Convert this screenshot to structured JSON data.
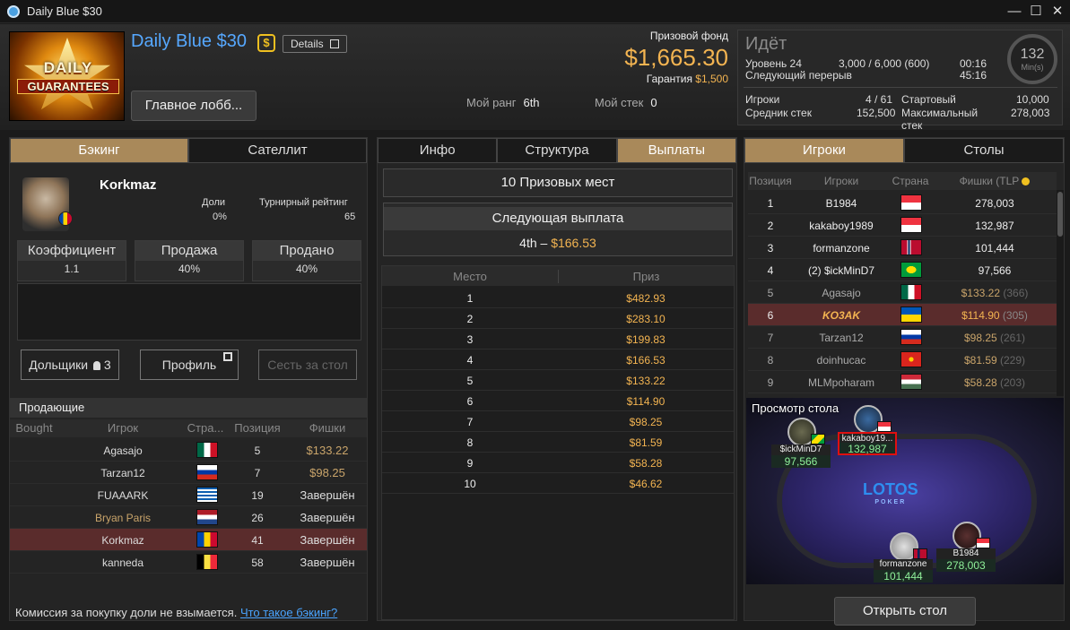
{
  "window": {
    "title": "Daily Blue $30"
  },
  "header": {
    "logo_line1": "DAILY",
    "logo_line2": "GUARANTEES",
    "tournament_name": "Daily Blue $30",
    "currency_badge": "$",
    "details_label": "Details",
    "lobby_button": "Главное лобб...",
    "prize_pool_label": "Призовой фонд",
    "prize_pool_amount": "$1,665.30",
    "guarantee_label": "Гарантия",
    "guarantee_amount": "$1,500",
    "my_rank_label": "Мой ранг",
    "my_rank_value": "6th",
    "my_stack_label": "Мой стек",
    "my_stack_value": "0"
  },
  "status": {
    "state": "Идёт",
    "level_label": "Уровень 24",
    "blinds": "3,000 / 6,000 (600)",
    "level_time": "00:16",
    "next_break_label": "Следующий перерыв",
    "break_time": "45:16",
    "clock_value": "132",
    "clock_unit": "Min(s)",
    "players_label": "Игроки",
    "players_value": "4 / 61",
    "starting_label": "Стартовый",
    "starting_value": "10,000",
    "avg_stack_label": "Средник стек",
    "avg_stack_value": "152,500",
    "max_label": "Максимальный стек",
    "max_value": "278,003"
  },
  "left": {
    "tabs": [
      "Бэкинг",
      "Сателлит"
    ],
    "player_name": "Korkmaz",
    "shares_label": "Доли",
    "shares_value": "0%",
    "rating_label": "Турнирный рейтинг",
    "rating_value": "65",
    "coef_label": "Коэффициент",
    "coef_value": "1.1",
    "sale_label": "Продажа",
    "sale_value": "40%",
    "sold_label": "Продано",
    "sold_value": "40%",
    "backers_button": "Дольщики",
    "backers_count": "3",
    "profile_button": "Профиль",
    "sit_button": "Сесть за стол",
    "sellers_title": "Продающие",
    "sellers_columns": [
      "Bought",
      "Игрок",
      "Стра...",
      "Позиция",
      "Фишки"
    ],
    "sellers": [
      {
        "name": "Agasajo",
        "flag": "mexico",
        "pos": "5",
        "chips": "$133.22"
      },
      {
        "name": "Tarzan12",
        "flag": "russia",
        "pos": "7",
        "chips": "$98.25"
      },
      {
        "name": "FUAAARK",
        "flag": "greece",
        "pos": "19",
        "chips": "Завершён"
      },
      {
        "name": "Bryan Paris",
        "flag": "netherlands",
        "pos": "26",
        "chips": "Завершён"
      },
      {
        "name": "Korkmaz",
        "flag": "moldova",
        "pos": "41",
        "chips": "Завершён"
      },
      {
        "name": "kanneda",
        "flag": "belgium",
        "pos": "58",
        "chips": "Завершён"
      }
    ],
    "commission_text": "Комиссия за покупку доли не взымается.",
    "commission_link": "Что такое бэкинг?"
  },
  "middle": {
    "tabs": [
      "Инфо",
      "Структура",
      "Выплаты"
    ],
    "prize_places": "10 Призовых мест",
    "next_payout_label": "Следующая выплата",
    "next_payout_place": "4th –",
    "next_payout_amount": "$166.53",
    "columns": [
      "Место",
      "Приз"
    ],
    "payouts": [
      {
        "place": "1",
        "amount": "$482.93"
      },
      {
        "place": "2",
        "amount": "$283.10"
      },
      {
        "place": "3",
        "amount": "$199.83"
      },
      {
        "place": "4",
        "amount": "$166.53"
      },
      {
        "place": "5",
        "amount": "$133.22"
      },
      {
        "place": "6",
        "amount": "$114.90"
      },
      {
        "place": "7",
        "amount": "$98.25"
      },
      {
        "place": "8",
        "amount": "$81.59"
      },
      {
        "place": "9",
        "amount": "$58.28"
      },
      {
        "place": "10",
        "amount": "$46.62"
      }
    ]
  },
  "right": {
    "tabs": [
      "Игроки",
      "Столы"
    ],
    "columns": [
      "Позиция",
      "Игроки",
      "Страна",
      "Фишки (TLP"
    ],
    "players": [
      {
        "pos": "1",
        "name": "B1984",
        "flag": "singapore",
        "chips": "278,003",
        "sub": ""
      },
      {
        "pos": "2",
        "name": "kakaboy1989",
        "flag": "singapore",
        "chips": "132,987",
        "sub": ""
      },
      {
        "pos": "3",
        "name": "formanzone",
        "flag": "norway",
        "chips": "101,444",
        "sub": ""
      },
      {
        "pos": "4",
        "name": "(2) $ickMinD7",
        "flag": "brazil",
        "chips": "97,566",
        "sub": ""
      },
      {
        "pos": "5",
        "name": "Agasajo",
        "flag": "mexico",
        "chips": "$133.22",
        "sub": "(366)"
      },
      {
        "pos": "6",
        "name": "KO3AK",
        "flag": "ukraine",
        "chips": "$114.90",
        "sub": "(305)"
      },
      {
        "pos": "7",
        "name": "Tarzan12",
        "flag": "russia",
        "chips": "$98.25",
        "sub": "(261)"
      },
      {
        "pos": "8",
        "name": "doinhucac",
        "flag": "vietnam",
        "chips": "$81.59",
        "sub": "(229)"
      },
      {
        "pos": "9",
        "name": "MLMpoharam",
        "flag": "hungary",
        "chips": "$58.28",
        "sub": "(203)"
      }
    ],
    "table_view_title": "Просмотр стола",
    "brand": "LOTOS",
    "brand_sub": "POKER",
    "seats": [
      {
        "name": "$ickMinD7",
        "chips": "97,566"
      },
      {
        "name": "kakaboy19...",
        "chips": "132,987"
      },
      {
        "name": "formanzone",
        "chips": "101,444"
      },
      {
        "name": "B1984",
        "chips": "278,003"
      }
    ],
    "open_table_button": "Открыть стол"
  }
}
